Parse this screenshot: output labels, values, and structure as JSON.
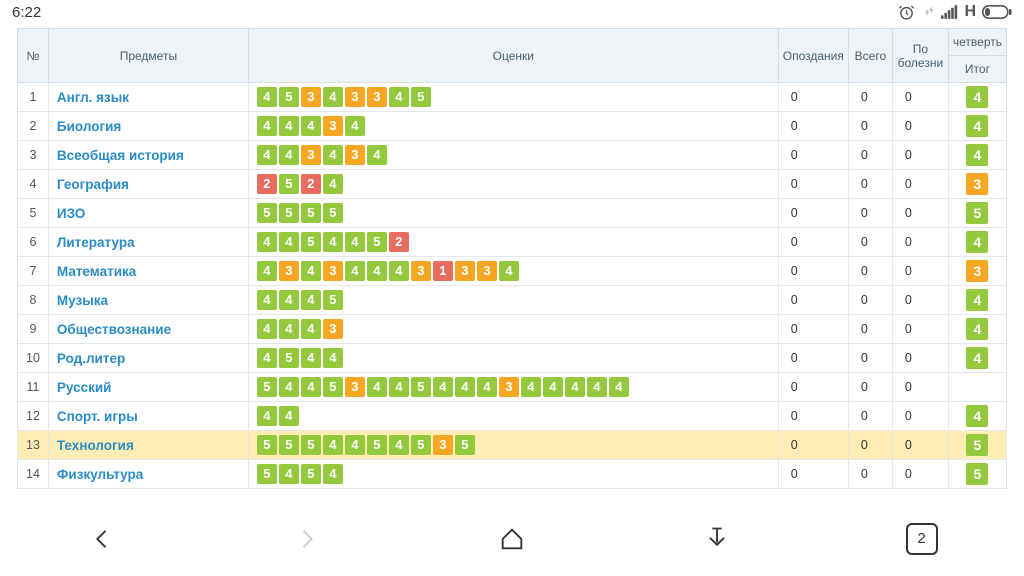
{
  "status": {
    "time": "6:22",
    "network": "H",
    "tabs_count": "2"
  },
  "headers": {
    "num": "№",
    "subjects": "Предметы",
    "grades": "Оценки",
    "late": "Опоздания",
    "total": "Всего",
    "sick": "По болезни",
    "term": "четверть",
    "result": "Итог"
  },
  "rows": [
    {
      "num": "1",
      "subject": "Англ. язык",
      "grades": [
        4,
        5,
        3,
        4,
        3,
        3,
        4,
        5
      ],
      "late": "0",
      "total": "0",
      "sick": "0",
      "term": 4
    },
    {
      "num": "2",
      "subject": "Биология",
      "grades": [
        4,
        4,
        4,
        3,
        4
      ],
      "late": "0",
      "total": "0",
      "sick": "0",
      "term": 4
    },
    {
      "num": "3",
      "subject": "Всеобщая история",
      "grades": [
        4,
        4,
        3,
        4,
        3,
        4
      ],
      "late": "0",
      "total": "0",
      "sick": "0",
      "term": 4
    },
    {
      "num": "4",
      "subject": "География",
      "grades": [
        2,
        5,
        2,
        4
      ],
      "late": "0",
      "total": "0",
      "sick": "0",
      "term": 3
    },
    {
      "num": "5",
      "subject": "ИЗО",
      "grades": [
        5,
        5,
        5,
        5
      ],
      "late": "0",
      "total": "0",
      "sick": "0",
      "term": 5
    },
    {
      "num": "6",
      "subject": "Литература",
      "grades": [
        4,
        4,
        5,
        4,
        4,
        5,
        2
      ],
      "late": "0",
      "total": "0",
      "sick": "0",
      "term": 4
    },
    {
      "num": "7",
      "subject": "Математика",
      "grades": [
        4,
        3,
        4,
        3,
        4,
        4,
        4,
        3,
        1,
        3,
        3,
        4
      ],
      "late": "0",
      "total": "0",
      "sick": "0",
      "term": 3
    },
    {
      "num": "8",
      "subject": "Музыка",
      "grades": [
        4,
        4,
        4,
        5
      ],
      "late": "0",
      "total": "0",
      "sick": "0",
      "term": 4
    },
    {
      "num": "9",
      "subject": "Обществознание",
      "grades": [
        4,
        4,
        4,
        3
      ],
      "late": "0",
      "total": "0",
      "sick": "0",
      "term": 4
    },
    {
      "num": "10",
      "subject": "Род.литер",
      "grades": [
        4,
        5,
        4,
        4
      ],
      "late": "0",
      "total": "0",
      "sick": "0",
      "term": 4
    },
    {
      "num": "11",
      "subject": "Русский",
      "grades": [
        5,
        4,
        4,
        5,
        3,
        4,
        4,
        5,
        4,
        4,
        4,
        3,
        4,
        4,
        4,
        4,
        4
      ],
      "late": "0",
      "total": "0",
      "sick": "0",
      "term": null
    },
    {
      "num": "12",
      "subject": "Спорт. игры",
      "grades": [
        4,
        4
      ],
      "late": "0",
      "total": "0",
      "sick": "0",
      "term": 4
    },
    {
      "num": "13",
      "subject": "Технология",
      "grades": [
        5,
        5,
        5,
        4,
        4,
        5,
        4,
        5,
        3,
        5
      ],
      "late": "0",
      "total": "0",
      "sick": "0",
      "term": 5,
      "highlighted": true
    },
    {
      "num": "14",
      "subject": "Физкультура",
      "grades": [
        5,
        4,
        5,
        4
      ],
      "late": "0",
      "total": "0",
      "sick": "0",
      "term": 5
    }
  ]
}
